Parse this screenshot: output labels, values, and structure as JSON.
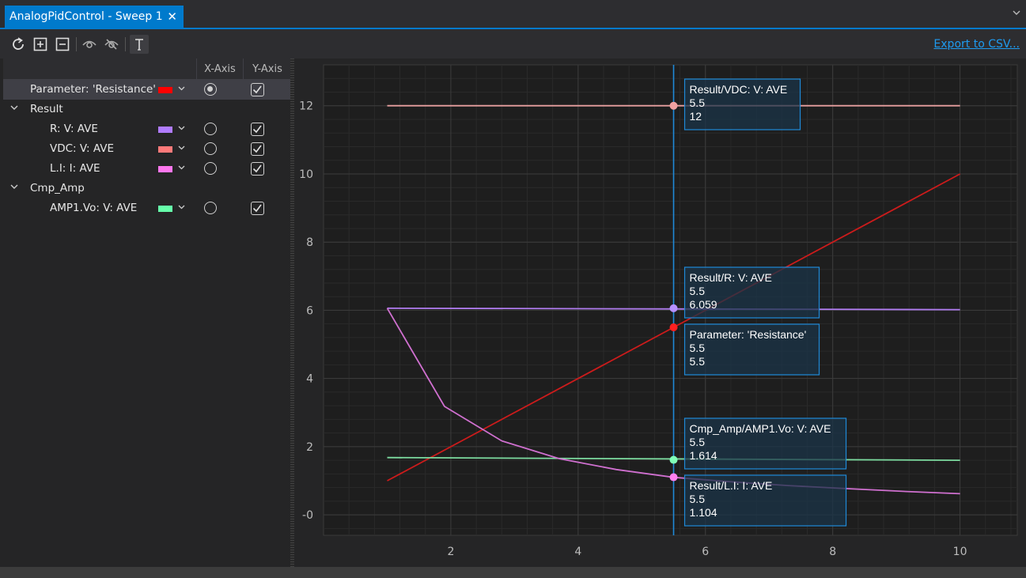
{
  "tab": {
    "title": "AnalogPidControl - Sweep 1"
  },
  "toolbar": {
    "export_label": "Export to CSV..."
  },
  "columns": {
    "x_axis": "X-Axis",
    "y_axis": "Y-Axis"
  },
  "tree": {
    "parameter": {
      "label": "Parameter: 'Resistance'",
      "color": "#ff0000",
      "x_axis": true,
      "y_axis": true
    },
    "groups": [
      {
        "label": "Result",
        "items": [
          {
            "label": "R: V: AVE",
            "color": "#b07cff",
            "x_axis": false,
            "y_axis": true
          },
          {
            "label": "VDC: V: AVE",
            "color": "#ff7a7a",
            "x_axis": false,
            "y_axis": true
          },
          {
            "label": "L.I: I: AVE",
            "color": "#ff77ee",
            "x_axis": false,
            "y_axis": true
          }
        ]
      },
      {
        "label": "Cmp_Amp",
        "items": [
          {
            "label": "AMP1.Vo: V: AVE",
            "color": "#66ffaa",
            "x_axis": false,
            "y_axis": true
          }
        ]
      }
    ]
  },
  "chart_data": {
    "type": "line",
    "xlim": [
      0,
      10.9
    ],
    "ylim": [
      -0.6,
      13.2
    ],
    "x_ticks": [
      2,
      4,
      6,
      8,
      10
    ],
    "y_ticks": [
      0,
      2,
      4,
      6,
      8,
      10,
      12
    ],
    "y_tick_labels": [
      "-0",
      "2",
      "4",
      "6",
      "8",
      "10",
      "12"
    ],
    "grid": true,
    "cursor_x": 5.5,
    "series": [
      {
        "color": "#e8a0a0",
        "x": [
          1,
          10
        ],
        "y": [
          12,
          12
        ]
      },
      {
        "color": "#cc1b1b",
        "x": [
          1,
          10
        ],
        "y": [
          1,
          10
        ]
      },
      {
        "color": "#b07cf0",
        "x": [
          1,
          10
        ],
        "y": [
          6.06,
          6.02
        ]
      },
      {
        "color": "#7ddca0",
        "x": [
          1,
          10
        ],
        "y": [
          1.68,
          1.6
        ]
      },
      {
        "color": "#d070d0",
        "x": [
          1,
          1.9,
          2.8,
          3.7,
          4.6,
          5.5,
          6.4,
          7.3,
          8.2,
          9.1,
          10
        ],
        "y": [
          6.06,
          3.18,
          2.17,
          1.65,
          1.33,
          1.1,
          0.97,
          0.86,
          0.77,
          0.69,
          0.62
        ]
      }
    ],
    "markers": [
      {
        "x": 5.5,
        "y": 12,
        "color": "#f0a0a0"
      },
      {
        "x": 5.5,
        "y": 6.059,
        "color": "#b890ff"
      },
      {
        "x": 5.5,
        "y": 5.5,
        "color": "#ff2020"
      },
      {
        "x": 5.5,
        "y": 1.614,
        "color": "#80ffb8"
      },
      {
        "x": 5.5,
        "y": 1.104,
        "color": "#ff80f0"
      }
    ],
    "tooltips": [
      {
        "lines": [
          "Result/VDC: V: AVE",
          "5.5",
          "12"
        ]
      },
      {
        "lines": [
          "Result/R: V: AVE",
          "5.5",
          "6.059"
        ]
      },
      {
        "lines": [
          "Parameter: 'Resistance'",
          "5.5",
          "5.5"
        ]
      },
      {
        "lines": [
          "Cmp_Amp/AMP1.Vo: V: AVE",
          "5.5",
          "1.614"
        ]
      },
      {
        "lines": [
          "Result/L.I: I: AVE",
          "5.5",
          "1.104"
        ]
      }
    ]
  }
}
